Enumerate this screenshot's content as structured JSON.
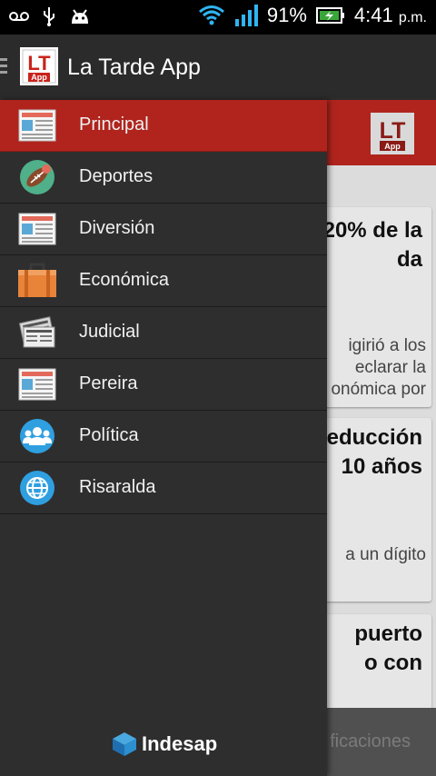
{
  "status_bar": {
    "battery": "91%",
    "time": "4:41",
    "ampm": "p.m."
  },
  "app": {
    "title": "La Tarde App",
    "logo_text": "LT",
    "logo_sub": "App"
  },
  "drawer": {
    "items": [
      {
        "label": "Principal",
        "icon": "newspaper-icon",
        "active": true
      },
      {
        "label": "Deportes",
        "icon": "football-icon",
        "active": false
      },
      {
        "label": "Diversión",
        "icon": "newspaper-icon",
        "active": false
      },
      {
        "label": "Económica",
        "icon": "briefcase-icon",
        "active": false
      },
      {
        "label": "Judicial",
        "icon": "newspapers-stack-icon",
        "active": false
      },
      {
        "label": "Pereira",
        "icon": "newspaper-icon",
        "active": false
      },
      {
        "label": "Política",
        "icon": "people-group-icon",
        "active": false
      },
      {
        "label": "Risaralda",
        "icon": "globe-icon",
        "active": false
      }
    ],
    "footer_brand": "Indesap"
  },
  "background": {
    "cards": [
      {
        "title_lines": [
          "20% de la",
          "da"
        ],
        "snippet_lines": [
          "igirió a los",
          "eclarar la",
          "onómica por"
        ]
      },
      {
        "title_lines": [
          "educción",
          "10 años"
        ],
        "snippet_lines": [
          "a un dígito"
        ]
      },
      {
        "title_lines": [
          "puerto",
          "o con"
        ],
        "snippet_lines": []
      }
    ],
    "bottom_text": "ficaciones"
  },
  "colors": {
    "accent": "#b0241d",
    "drawer_bg": "#2e2e2e",
    "action_bar": "#2b2b2b"
  }
}
